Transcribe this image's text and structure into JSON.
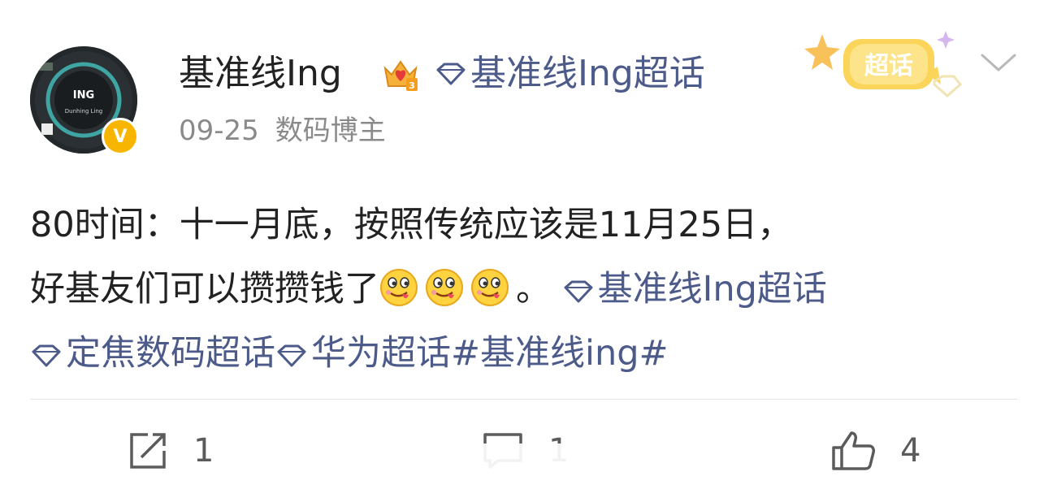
{
  "author": {
    "name": "基准线Ing",
    "super_topic": "基准线Ing超话",
    "date": "09-25",
    "role": "数码博主",
    "verified_mark": "V",
    "avatar_text_1": "ING",
    "avatar_text_2": "Dunhing Ling"
  },
  "badge": {
    "label": "超话"
  },
  "post": {
    "text_line1": "80时间：十一月底，按照传统应该是11月25日，",
    "text_line2_prefix": "好基友们可以攒攒钱了",
    "text_line2_suffix": "。",
    "topic_1": "基准线Ing超话",
    "topic_2": "定焦数码超话",
    "topic_3": "华为超话",
    "hashtag": "#基准线ing#",
    "emoji_name": "drooling-face-emoji"
  },
  "actions": {
    "share_count": "1",
    "comment_count": "1",
    "like_count": "4"
  },
  "colors": {
    "link": "#4d5b8a",
    "verified": "#f7b500",
    "meta": "#8a8a8a"
  }
}
